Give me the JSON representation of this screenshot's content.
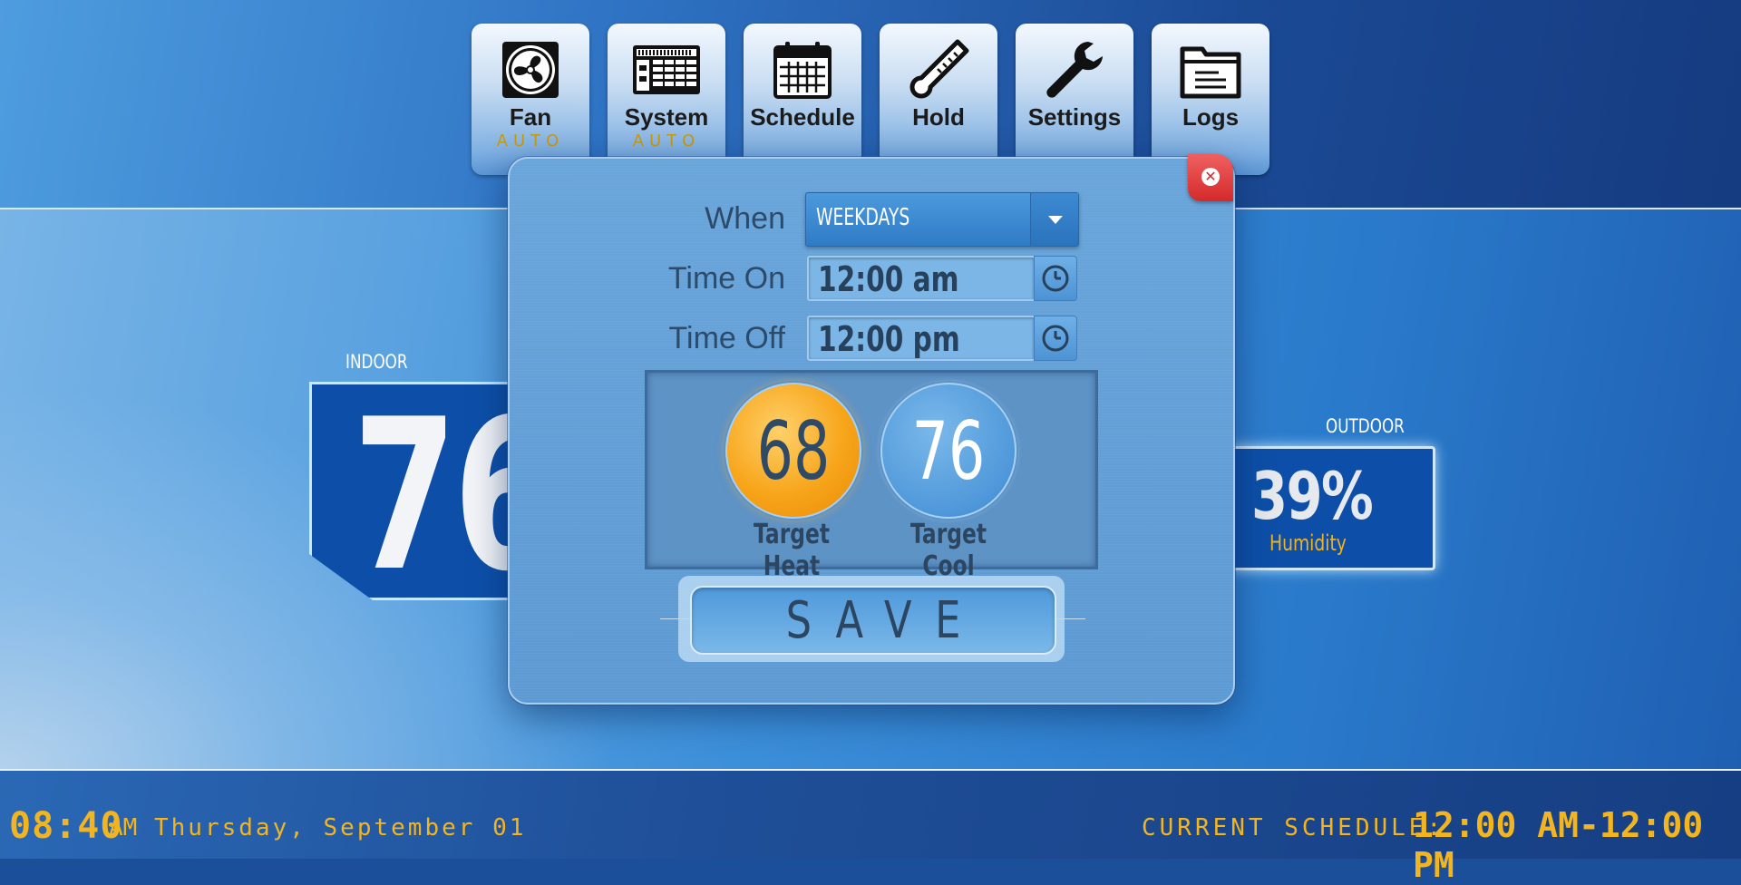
{
  "nav": {
    "items": [
      {
        "label": "Fan",
        "sub": "AUTO",
        "icon": "fan-icon"
      },
      {
        "label": "System",
        "sub": "AUTO",
        "icon": "system-unit-icon"
      },
      {
        "label": "Schedule",
        "sub": "",
        "icon": "calendar-icon"
      },
      {
        "label": "Hold",
        "sub": "",
        "icon": "thermometer-icon"
      },
      {
        "label": "Settings",
        "sub": "",
        "icon": "wrench-icon"
      },
      {
        "label": "Logs",
        "sub": "",
        "icon": "folder-icon"
      }
    ]
  },
  "indoor": {
    "label": "INDOOR",
    "value": "76"
  },
  "outdoor": {
    "label": "OUTDOOR",
    "humidity_value": "39%",
    "humidity_label": "Humidity"
  },
  "modal": {
    "when_label": "When",
    "when_value": "WEEKDAYS",
    "time_on_label": "Time On",
    "time_on_value": "12:00 am",
    "time_off_label": "Time Off",
    "time_off_value": "12:00 pm",
    "target_heat_value": "68",
    "target_heat_label": "Target Heat",
    "target_cool_value": "76",
    "target_cool_label": "Target Cool",
    "save_label": "SAVE",
    "close_icon": "close-icon"
  },
  "footer": {
    "time": "08:40",
    "ampm": "AM",
    "date": "Thursday, September 01",
    "schedule_label": "CURRENT SCHEDULE:",
    "schedule_value": "12:00 AM-12:00 PM"
  },
  "colors": {
    "accent_gold": "#f2b51f",
    "heat_orange": "#f7a51a",
    "cool_blue": "#4f98da",
    "close_red": "#d42a2a"
  }
}
